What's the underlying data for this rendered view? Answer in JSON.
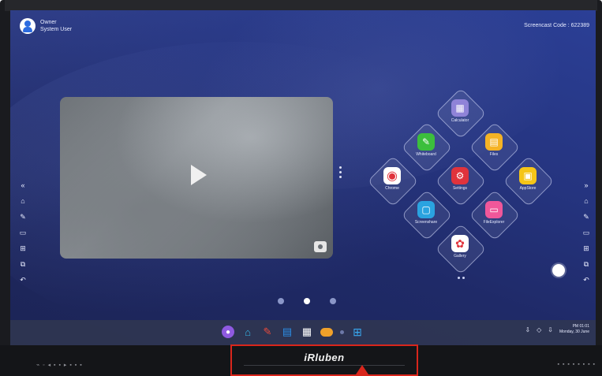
{
  "user": {
    "role": "Owner",
    "name": "System User"
  },
  "screencast_code": "Screencast Code : 622389",
  "apps": [
    {
      "label": "Calculator",
      "color": "#8f83d8",
      "glyph": "▦",
      "icon": "calculator-icon"
    },
    {
      "label": "Whiteboard",
      "color": "#3cbf3c",
      "glyph": "✎",
      "icon": "whiteboard-icon"
    },
    {
      "label": "Files",
      "color": "#f5b325",
      "glyph": "▤",
      "icon": "folder-icon"
    },
    {
      "label": "Chrome",
      "color": "#ffffff",
      "glyph": "◉",
      "icon": "chrome-icon"
    },
    {
      "label": "Settings",
      "color": "#e0333c",
      "glyph": "⚙",
      "icon": "settings-icon"
    },
    {
      "label": "AppStore",
      "color": "#f5c518",
      "glyph": "▣",
      "icon": "appstore-icon"
    },
    {
      "label": "Screenshare",
      "color": "#2aa3e0",
      "glyph": "▢",
      "icon": "screenshare-icon"
    },
    {
      "label": "FileExplorer",
      "color": "#f0579a",
      "glyph": "▭",
      "icon": "media-icon"
    },
    {
      "label": "Gallery",
      "color": "#ffffff",
      "glyph": "✿",
      "icon": "gallery-icon"
    }
  ],
  "clock": {
    "time": "PM 01:01",
    "date": "Monday, 30 June"
  },
  "brand": "iRluben",
  "colors": {
    "accent": "#2c6be0",
    "highlight_box": "#d9261c"
  }
}
